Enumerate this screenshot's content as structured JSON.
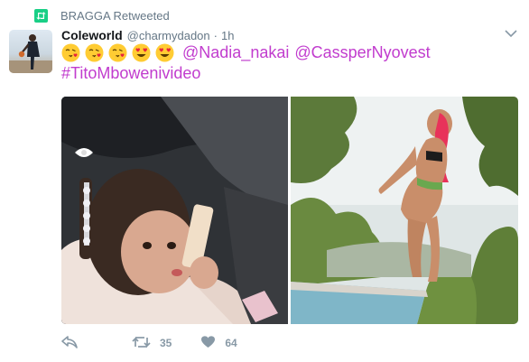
{
  "retweet_context": {
    "label": "BRAGGA Retweeted",
    "icon": "retweet-icon",
    "icon_color": "#19cf86"
  },
  "tweet": {
    "author_name": "Coleworld",
    "author_handle": "@charmydadon",
    "separator": "·",
    "time": "1h",
    "emojis": [
      "kissing-face-with-heart",
      "kissing-face-with-heart",
      "kissing-face-with-heart",
      "heart-eyes",
      "heart-eyes"
    ],
    "mentions": [
      "@Nadia_nakai",
      "@CassperNyovest"
    ],
    "hashtag": "#TitoMbowenivideo",
    "link_color": "#c13cce"
  },
  "media": {
    "photos": [
      "photo-child-with-phone",
      "photo-woman-poolside"
    ]
  },
  "actions": {
    "reply_icon": "reply-icon",
    "retweet_icon": "retweet-icon",
    "retweet_count": "35",
    "like_icon": "heart-icon",
    "like_count": "64"
  },
  "colors": {
    "text_primary": "#14171a",
    "text_secondary": "#657786",
    "action_gray": "#8899a6"
  }
}
